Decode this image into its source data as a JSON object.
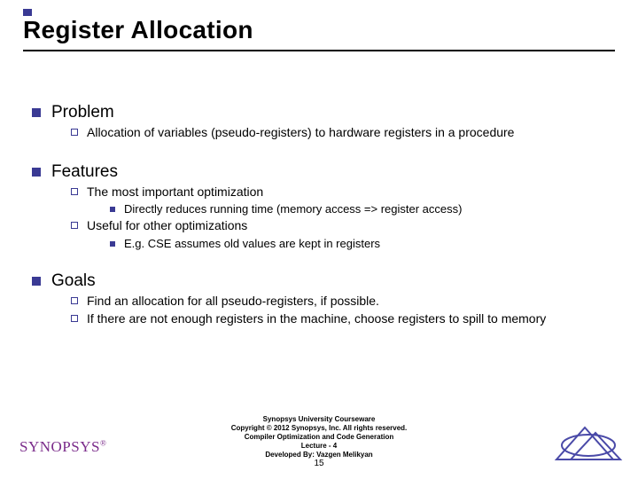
{
  "title": "Register Allocation",
  "sections": [
    {
      "heading": "Problem",
      "items": [
        {
          "text": "Allocation of variables (pseudo-registers) to hardware registers in a procedure"
        }
      ]
    },
    {
      "heading": "Features",
      "items": [
        {
          "text": "The most important optimization",
          "sub": [
            "Directly reduces running time  (memory access => register access)"
          ]
        },
        {
          "text": "Useful for other optimizations",
          "sub": [
            "E.g.  CSE assumes old values are kept in registers"
          ]
        }
      ]
    },
    {
      "heading": "Goals",
      "items": [
        {
          "text": "Find an allocation for all pseudo-registers, if possible."
        },
        {
          "text": "If there are not enough registers in the machine, choose registers to spill to memory"
        }
      ]
    }
  ],
  "footer": {
    "logo": "SYNOPSYS",
    "logo_tm": "®",
    "credits": [
      "Synopsys University Courseware",
      "Copyright © 2012 Synopsys, Inc. All rights reserved.",
      "Compiler Optimization and Code Generation",
      "Lecture - 4",
      "Developed By: Vazgen Melikyan"
    ],
    "page": "15"
  }
}
